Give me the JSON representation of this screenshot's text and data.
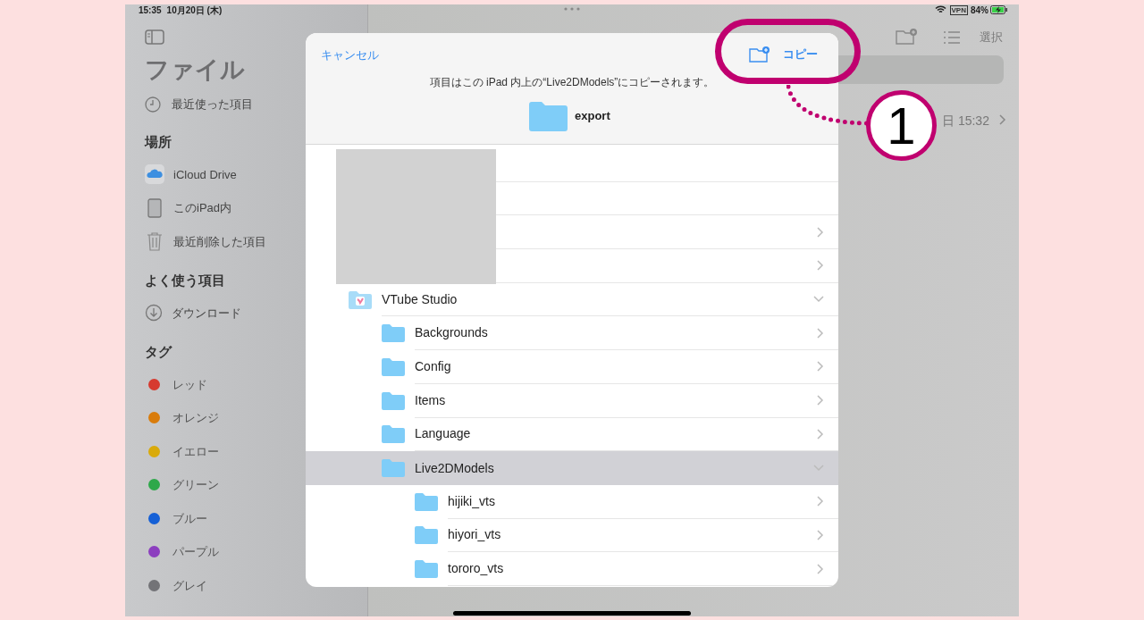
{
  "status_bar": {
    "time": "15:35",
    "date": "10月20日 (木)",
    "vpn": "VPN",
    "battery": "84%",
    "charging": true
  },
  "sidebar": {
    "title": "ファイル",
    "recents": "最近使った項目",
    "sections": [
      {
        "heading": "場所",
        "items": [
          {
            "label": "iCloud Drive",
            "kind": "cloud"
          },
          {
            "label": "このiPad内",
            "kind": "ipad"
          },
          {
            "label": "最近削除した項目",
            "kind": "trash"
          }
        ]
      },
      {
        "heading": "よく使う項目",
        "items": [
          {
            "label": "ダウンロード",
            "kind": "download"
          }
        ]
      },
      {
        "heading": "タグ",
        "items": [
          {
            "label": "レッド",
            "kind": "tag",
            "color": "#d63a2f"
          },
          {
            "label": "オレンジ",
            "kind": "tag",
            "color": "#d97c0b"
          },
          {
            "label": "イエロー",
            "kind": "tag",
            "color": "#d9aa0b"
          },
          {
            "label": "グリーン",
            "kind": "tag",
            "color": "#2ea84a"
          },
          {
            "label": "ブルー",
            "kind": "tag",
            "color": "#1560d6"
          },
          {
            "label": "パープル",
            "kind": "tag",
            "color": "#8c3fbf"
          },
          {
            "label": "グレイ",
            "kind": "tag",
            "color": "#737377"
          }
        ]
      }
    ]
  },
  "main": {
    "select_button": "選択",
    "row_date": "日 15:32"
  },
  "dialog": {
    "cancel": "キャンセル",
    "copy": "コピー",
    "message": "項目はこの iPad 内上の“Live2DModels”にコピーされます。",
    "file_name": "export",
    "tree": [
      {
        "kind": "obscured",
        "chevron": false
      },
      {
        "kind": "obscured",
        "chevron": false
      },
      {
        "kind": "obscured",
        "chevron": true
      },
      {
        "kind": "obscured",
        "chevron": true
      },
      {
        "kind": "app",
        "label": "VTube Studio",
        "expanded": true,
        "selected": false,
        "children": [
          {
            "kind": "folder",
            "label": "Backgrounds",
            "expanded": false,
            "selected": false
          },
          {
            "kind": "folder",
            "label": "Config",
            "expanded": false,
            "selected": false
          },
          {
            "kind": "folder",
            "label": "Items",
            "expanded": false,
            "selected": false
          },
          {
            "kind": "folder",
            "label": "Language",
            "expanded": false,
            "selected": false
          },
          {
            "kind": "folder",
            "label": "Live2DModels",
            "expanded": true,
            "selected": true,
            "children": [
              {
                "kind": "folder",
                "label": "hijiki_vts",
                "expanded": false,
                "selected": false
              },
              {
                "kind": "folder",
                "label": "hiyori_vts",
                "expanded": false,
                "selected": false
              },
              {
                "kind": "folder",
                "label": "tororo_vts",
                "expanded": false,
                "selected": false
              }
            ]
          }
        ]
      }
    ]
  },
  "annotation": {
    "number": "1"
  }
}
